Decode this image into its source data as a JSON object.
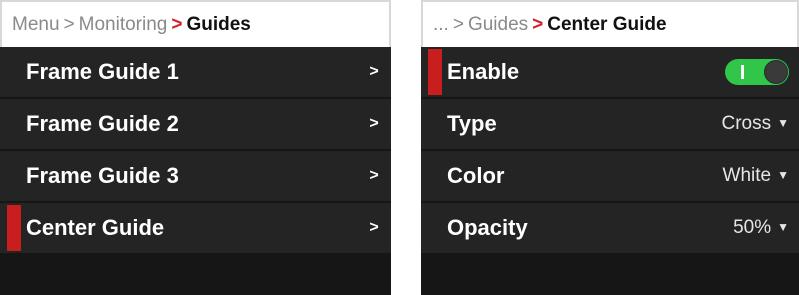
{
  "left_panel": {
    "breadcrumb": {
      "menu": "Menu",
      "sep1": ">",
      "monitoring": "Monitoring",
      "sep2": ">",
      "current": "Guides"
    },
    "items": [
      {
        "label": "Frame Guide 1",
        "chevron": ">"
      },
      {
        "label": "Frame Guide 2",
        "chevron": ">"
      },
      {
        "label": "Frame Guide 3",
        "chevron": ">"
      },
      {
        "label": "Center Guide",
        "chevron": ">",
        "selected": true
      }
    ]
  },
  "right_panel": {
    "breadcrumb": {
      "ellipsis": "...",
      "sep1": ">",
      "guides": "Guides",
      "sep2": ">",
      "current": "Center Guide"
    },
    "settings": [
      {
        "label": "Enable",
        "toggle_on": true,
        "selected": true
      },
      {
        "label": "Type",
        "value": "Cross",
        "arrow": "▼"
      },
      {
        "label": "Color",
        "value": "White",
        "arrow": "▼"
      },
      {
        "label": "Opacity",
        "value": "50%",
        "arrow": "▼"
      }
    ]
  },
  "colors": {
    "accent_red": "#d6202c",
    "selection_bar": "#c81e1e",
    "toggle_on": "#2fc64a",
    "row_bg": "#242424",
    "screen_bg": "#161616"
  },
  "icons": {
    "chevron": "chevron-right-icon",
    "dropdown": "chevron-down-icon",
    "toggle": "toggle-switch"
  }
}
